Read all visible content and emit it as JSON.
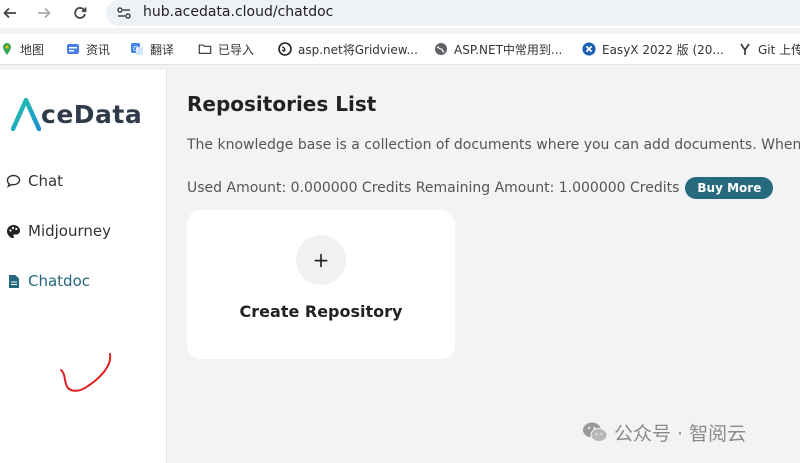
{
  "browser": {
    "url": "hub.acedata.cloud/chatdoc",
    "bookmarks": [
      {
        "label": "地图",
        "icon": "maps-icon"
      },
      {
        "label": "资讯",
        "icon": "news-icon"
      },
      {
        "label": "翻译",
        "icon": "translate-icon"
      },
      {
        "label": "已导入",
        "icon": "folder-icon"
      },
      {
        "label": "asp.net将Gridview...",
        "icon": "site-icon"
      },
      {
        "label": "ASP.NET中常用到...",
        "icon": "globe-icon"
      },
      {
        "label": "EasyX 2022 版 (20...",
        "icon": "easyx-icon"
      },
      {
        "label": "Git 上传",
        "icon": "git-icon"
      }
    ]
  },
  "sidebar": {
    "logo_text": "ceData",
    "items": [
      {
        "label": "Chat",
        "icon": "chat-bubble-icon"
      },
      {
        "label": "Midjourney",
        "icon": "palette-icon"
      },
      {
        "label": "Chatdoc",
        "icon": "document-icon",
        "active": true
      }
    ]
  },
  "main": {
    "title": "Repositories List",
    "description": "The knowledge base is a collection of documents where you can add documents. When the",
    "used_amount": "Used Amount: 0.000000 Credits Remaining Amount: 1.000000 Credits",
    "buy_label": "Buy More",
    "create_plus": "+",
    "create_label": "Create Repository"
  },
  "watermark": "公众号 · 智阅云",
  "colors": {
    "accent": "#27697f",
    "logo_teal": "#1fb3b3",
    "annotation": "#e02020"
  }
}
